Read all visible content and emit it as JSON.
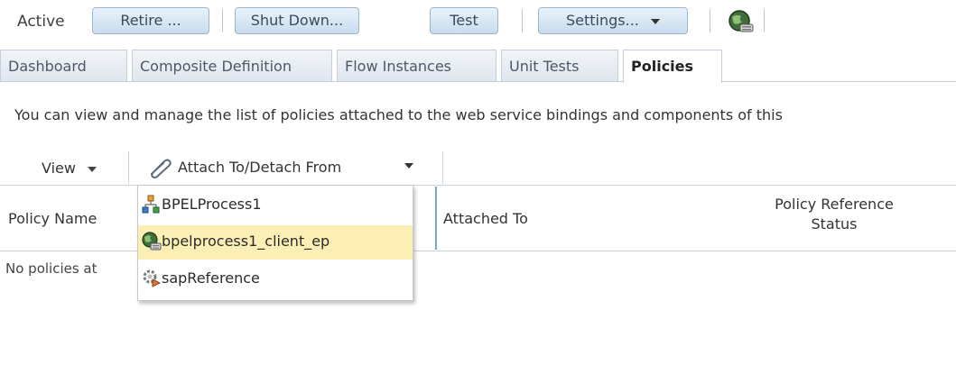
{
  "toolbar": {
    "status": "Active",
    "retire_label": "Retire ...",
    "shutdown_label": "Shut Down...",
    "test_label": "Test",
    "settings_label": "Settings...",
    "globe_icon": "service-globe-icon"
  },
  "tabs": [
    {
      "label": "Dashboard"
    },
    {
      "label": "Composite Definition"
    },
    {
      "label": "Flow Instances"
    },
    {
      "label": "Unit Tests"
    },
    {
      "label": "Policies",
      "active": true
    }
  ],
  "intro": "You can view and manage the list of policies attached to the web service bindings and components of this",
  "table_toolbar": {
    "view_label": "View",
    "attach_label": "Attach To/Detach From",
    "attach_icon": "paperclip-icon"
  },
  "table": {
    "columns": {
      "policy_name": "Policy Name",
      "attached_to": "Attached To",
      "ref_status_line1": "Policy Reference",
      "ref_status_line2": "Status"
    },
    "empty_text": "No policies at"
  },
  "menu": {
    "items": [
      {
        "label": "BPELProcess1",
        "icon": "bpel-process-icon"
      },
      {
        "label": "bpelprocess1_client_ep",
        "icon": "service-globe-icon",
        "highlighted": true
      },
      {
        "label": "sapReference",
        "icon": "reference-gear-icon"
      }
    ]
  }
}
